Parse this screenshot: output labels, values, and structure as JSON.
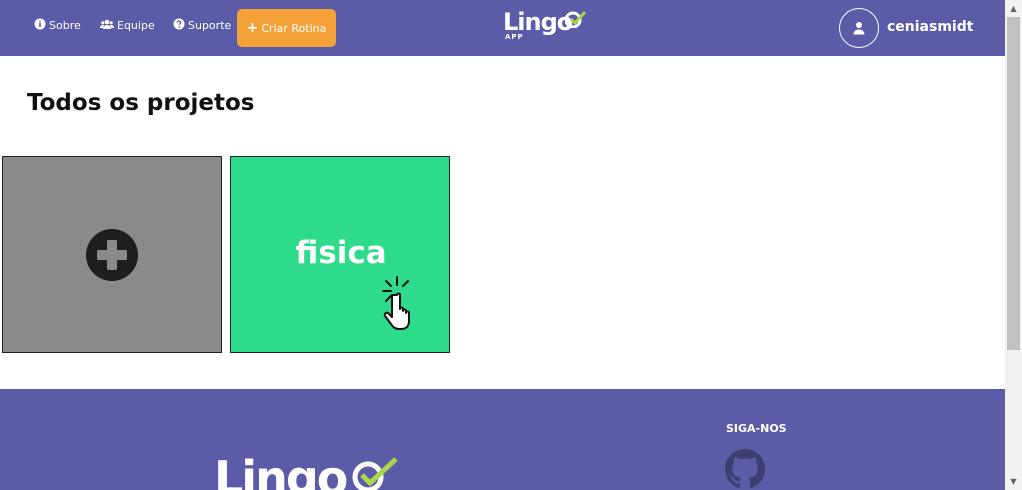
{
  "nav": {
    "sobre": "Sobre",
    "equipe": "Equipe",
    "suporte": "Suporte",
    "criar_rotina": "Criar Rotina"
  },
  "logo": {
    "word": "Lingo",
    "sub": "APP"
  },
  "user": {
    "name": "ceniasmidt",
    "icon": "user-icon"
  },
  "main": {
    "title": "Todos os projetos",
    "new_card_icon": "plus-circle-icon",
    "projects": [
      {
        "name": "fisica"
      }
    ]
  },
  "footer": {
    "logo": "Lingo",
    "follow_label": "SIGA-NOS",
    "social_icon": "github-icon"
  },
  "colors": {
    "primary": "#5b5ba8",
    "accent": "#f4a13a",
    "project_card": "#2edb8b",
    "new_card": "#8a8a8a",
    "check": "#a8d84a"
  }
}
